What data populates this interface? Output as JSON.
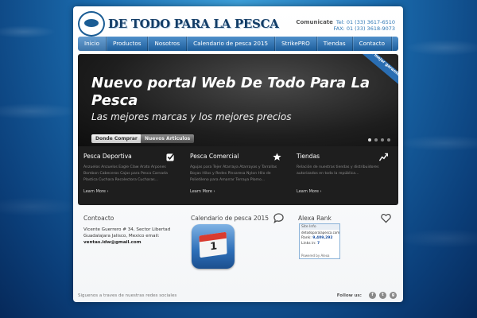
{
  "header": {
    "logo_text": "DE TODO PARA LA PESCA",
    "contact_label": "Comunicate",
    "tel": "Tel: 01 (33) 3617-6510",
    "fax": "FAX: 01 (33) 3618-9073"
  },
  "nav": {
    "items": [
      {
        "label": "Inicio"
      },
      {
        "label": "Productos"
      },
      {
        "label": "Nosotros"
      },
      {
        "label": "Calendario de pesca 2015"
      },
      {
        "label": "StrikePRO"
      },
      {
        "label": "Tiendas"
      },
      {
        "label": "Contacto"
      }
    ]
  },
  "hero": {
    "title": "Nuevo portal Web De Todo Para La Pesca",
    "subtitle": "Las mejores marcas y los mejores precios",
    "button_primary": "Donde Comprar",
    "button_secondary": "Nuevos Articulos",
    "ribbon": "La mejor garantia",
    "slide_count": 4,
    "active_slide": 1
  },
  "features": [
    {
      "title": "Pesca Deportiva",
      "text": "Anzuelos Anzuelos Eagle Claw Arato Arpones Bombon Cabeceros Cajas para Pesca Carnada Plastica Cuchara Recolectora Cucharas...",
      "more": "Learn More ›",
      "icon": "checkbox-icon"
    },
    {
      "title": "Pesca Comercial",
      "text": "Agujas para Tejer Atarraya Atarrayas y Tarrallas Boyas Hilos y Redes Pinsaresa Nylon Hilo de Polietileno para Amarrar Terraya Plomo...",
      "more": "Learn More ›",
      "icon": "star-icon"
    },
    {
      "title": "Tiendas",
      "text": "Relación de nuestras tiendas y distribuidores autorizados en toda la república...",
      "more": "Learn More ›",
      "icon": "chart-icon"
    }
  ],
  "contact": {
    "title": "Contoacto",
    "address1": "Vicente Guerrero # 34, Sector Libertad",
    "address2": "Guadalajara Jalisco, Mexico email:",
    "email": "ventas.idw@gmail.com"
  },
  "calendar": {
    "title": "Calendario de pesca 2015",
    "day": "1"
  },
  "alexa": {
    "title": "Alexa Rank",
    "widget_head": "Site Info",
    "widget_url": "detodoparalapesca.com",
    "rank_label": "Rank:",
    "rank_value": "9,409,292",
    "links_label": "Links in:",
    "links_value": "7",
    "powered": "Powered by Alexa"
  },
  "footer": {
    "text": "Siguenos a traves de nuestras redes sociales",
    "follow": "Follow us:",
    "social": [
      {
        "glyph": "f"
      },
      {
        "glyph": "t"
      },
      {
        "glyph": "g"
      }
    ]
  },
  "colors": {
    "nav_top": "#4f8fca",
    "nav_bottom": "#1d5e9c",
    "contact_blue": "#2f78b6",
    "hero_dark": "#1e1e1e"
  }
}
